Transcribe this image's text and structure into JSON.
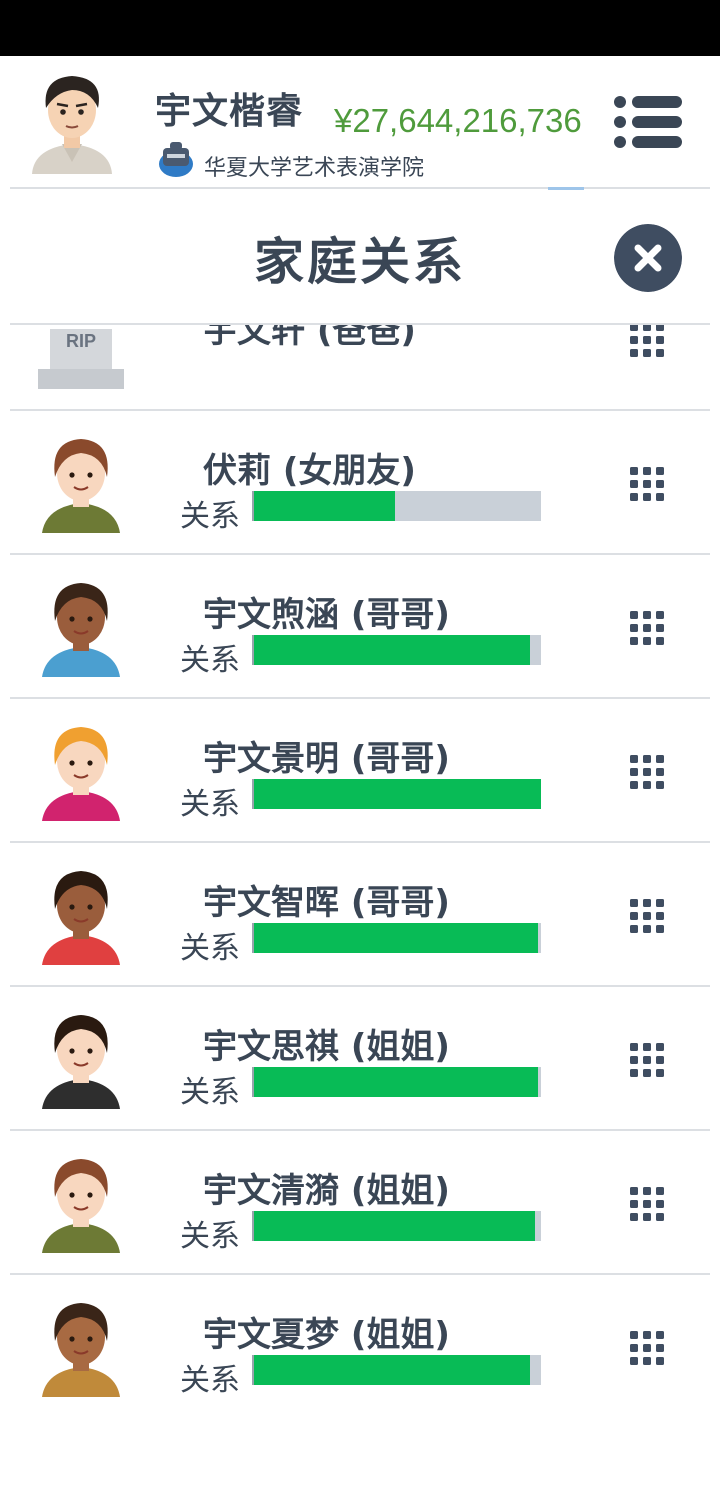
{
  "header": {
    "player_name": "宇文楷睿",
    "money": "¥27,644,216,736",
    "school": "华夏大学艺术表演学院"
  },
  "modal": {
    "title": "家庭关系"
  },
  "deceased_row": {
    "name_partial": "宇文轩 (爸爸)",
    "rip": "RIP"
  },
  "relation_label": "关系",
  "members": [
    {
      "name": "伏莉 (女朋友)",
      "relationship": 0.49,
      "skin": "#f8d7bf",
      "hair": "#8a4a2c",
      "shirt": "#6d7a35"
    },
    {
      "name": "宇文煦涵 (哥哥)",
      "relationship": 0.96,
      "skin": "#9a5d3c",
      "hair": "#3a2518",
      "shirt": "#4b9fd0"
    },
    {
      "name": "宇文景明 (哥哥)",
      "relationship": 1.0,
      "skin": "#f8d7bf",
      "hair": "#f0a030",
      "shirt": "#d1236e"
    },
    {
      "name": "宇文智晖 (哥哥)",
      "relationship": 0.99,
      "skin": "#9a5d3c",
      "hair": "#2a1a10",
      "shirt": "#e04040"
    },
    {
      "name": "宇文思祺 (姐姐)",
      "relationship": 0.99,
      "skin": "#f8d7bf",
      "hair": "#2a1a10",
      "shirt": "#2e2e2e"
    },
    {
      "name": "宇文清漪 (姐姐)",
      "relationship": 0.98,
      "skin": "#f8d7bf",
      "hair": "#8a4a2c",
      "shirt": "#6d7a35"
    },
    {
      "name": "宇文夏梦 (姐姐)",
      "relationship": 0.96,
      "skin": "#a86a42",
      "hair": "#3a2518",
      "shirt": "#c08a3a"
    }
  ]
}
